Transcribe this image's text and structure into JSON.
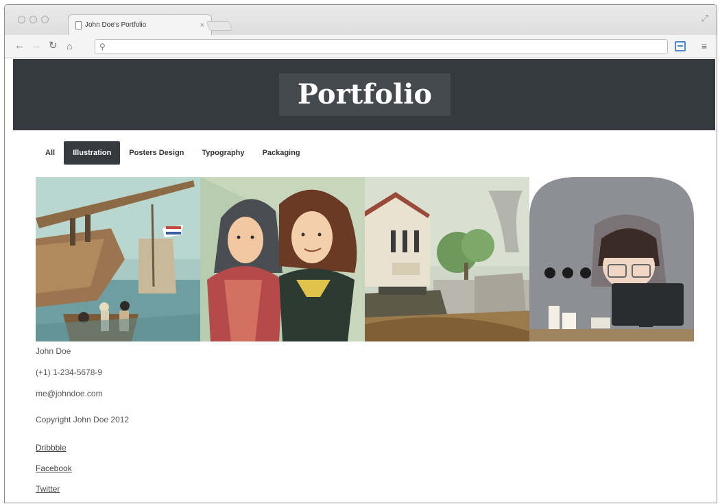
{
  "browser": {
    "tab_title": "John Doe's Portfolio",
    "tab_close": "×",
    "address": ""
  },
  "header": {
    "title": "Portfolio"
  },
  "filters": [
    {
      "label": "All",
      "active": false
    },
    {
      "label": "Illustration",
      "active": true
    },
    {
      "label": "Posters Design",
      "active": false
    },
    {
      "label": "Typography",
      "active": false
    },
    {
      "label": "Packaging",
      "active": false
    }
  ],
  "gallery": [
    {
      "name": "ships-illustration"
    },
    {
      "name": "hooded-characters-illustration"
    },
    {
      "name": "town-tank-illustration"
    },
    {
      "name": "laptop-character-illustration"
    }
  ],
  "contact": {
    "name": "John Doe",
    "phone": "(+1) 1-234-5678-9",
    "email": "me@johndoe.com",
    "copyright": "Copyright John Doe 2012"
  },
  "social": {
    "dribbble": "Dribbble",
    "facebook": "Facebook",
    "twitter": "Twitter"
  },
  "colors": {
    "header_bg": "#353a40",
    "active_filter_bg": "#353a40",
    "title_text": "#ffffff"
  }
}
